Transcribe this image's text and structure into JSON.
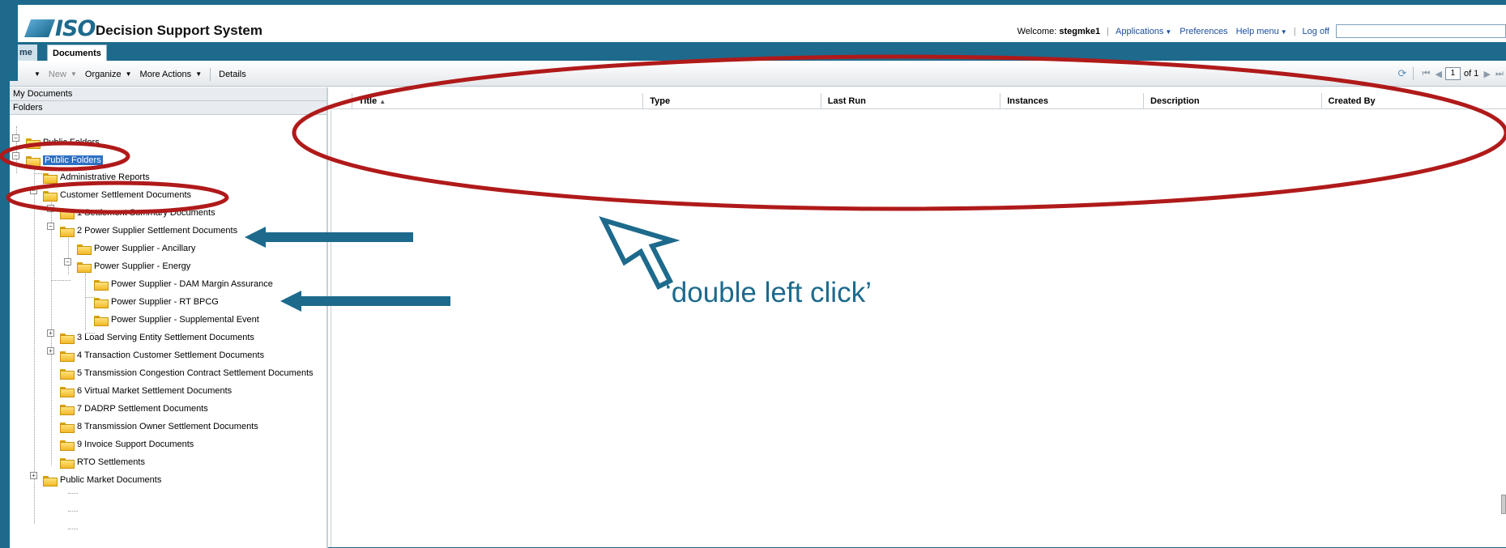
{
  "header": {
    "title": "Decision Support System",
    "logo": "ISO",
    "welcome_label": "Welcome:",
    "username": "stegmke1",
    "applications": "Applications",
    "preferences": "Preferences",
    "help": "Help menu",
    "logoff": "Log off",
    "search_placeholder": ""
  },
  "tabs": [
    {
      "label": "me"
    },
    {
      "label": "Documents"
    }
  ],
  "toolbar": {
    "new": "New",
    "organize": "Organize",
    "more_actions": "More Actions",
    "details": "Details",
    "page_value": "1",
    "page_of": "of 1"
  },
  "left_panel": {
    "my_documents": "My Documents",
    "folders": "Folders",
    "tree": [
      "Public Folders",
      "Public Folders",
      "Administrative Reports",
      "Customer Settlement Documents",
      "1 Settlement Summary Documents",
      "2 Power Supplier Settlement Documents",
      "Power Supplier - Ancillary",
      "Power Supplier - Energy",
      "Power Supplier - DAM Margin Assurance",
      "Power Supplier - RT BPCG",
      "Power Supplier - Supplemental Event",
      "3 Load Serving Entity Settlement Documents",
      "4 Transaction Customer Settlement Documents",
      "5 Transmission Congestion Contract Settlement Documents",
      "6 Virtual Market Settlement Documents",
      "7 DADRP Settlement Documents",
      "8 Transmission Owner Settlement Documents",
      "9 Invoice Support Documents",
      "RTO Settlements",
      "Public Market Documents"
    ]
  },
  "grid": {
    "columns": [
      "Title",
      "Type",
      "Last Run",
      "Instances",
      "Description",
      "Created By"
    ]
  },
  "annotation": {
    "caption": "‘double left click’",
    "highlight_color": "#b01a1a",
    "arrow_color": "#1d6a8c"
  }
}
